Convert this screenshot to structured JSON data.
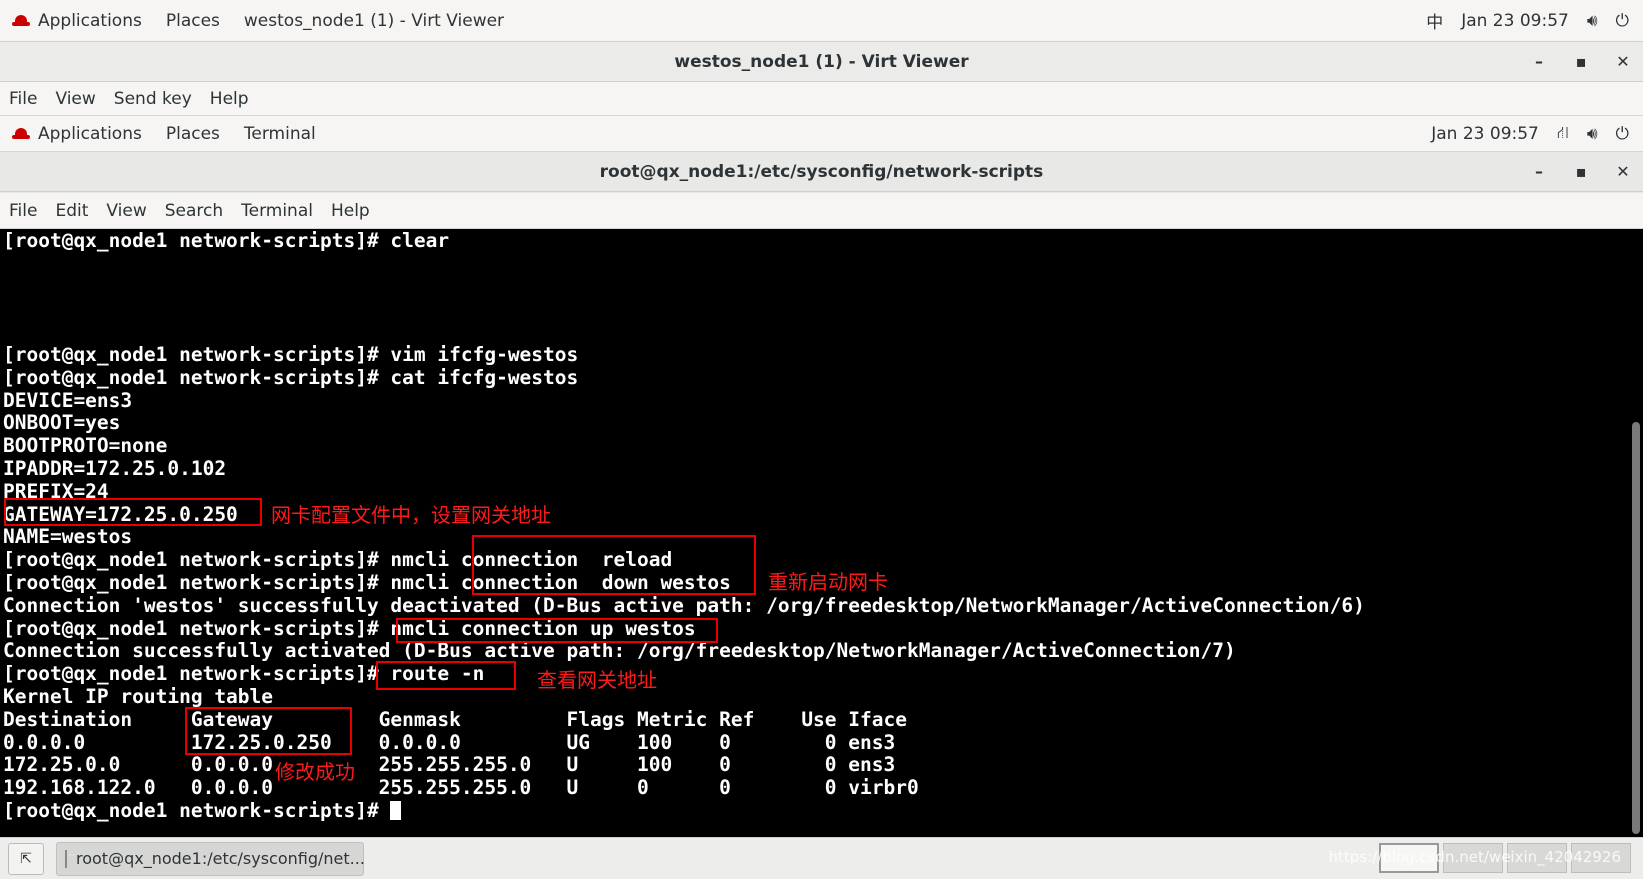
{
  "host_top_bar": {
    "applications": "Applications",
    "places": "Places",
    "window_title": "westos_node1 (1) - Virt Viewer",
    "input_method": "中",
    "datetime": "Jan 23  09:57"
  },
  "viewer_window": {
    "title": "westos_node1 (1) - Virt Viewer",
    "menu": [
      "File",
      "View",
      "Send key",
      "Help"
    ]
  },
  "guest_top_bar": {
    "applications": "Applications",
    "places": "Places",
    "app": "Terminal",
    "datetime": "Jan 23  09:57"
  },
  "terminal_window": {
    "title": "root@qx_node1:/etc/sysconfig/network-scripts",
    "menu": [
      "File",
      "Edit",
      "View",
      "Search",
      "Terminal",
      "Help"
    ]
  },
  "terminal": {
    "lines": [
      "[root@qx_node1 network-scripts]# clear",
      "",
      "",
      "",
      "",
      "[root@qx_node1 network-scripts]# vim ifcfg-westos",
      "[root@qx_node1 network-scripts]# cat ifcfg-westos",
      "DEVICE=ens3",
      "ONBOOT=yes",
      "BOOTPROTO=none",
      "IPADDR=172.25.0.102",
      "PREFIX=24",
      "GATEWAY=172.25.0.250",
      "NAME=westos",
      "[root@qx_node1 network-scripts]# nmcli connection  reload",
      "[root@qx_node1 network-scripts]# nmcli connection  down westos",
      "Connection 'westos' successfully deactivated (D-Bus active path: /org/freedesktop/NetworkManager/ActiveConnection/6)",
      "[root@qx_node1 network-scripts]# nmcli connection up westos",
      "Connection successfully activated (D-Bus active path: /org/freedesktop/NetworkManager/ActiveConnection/7)",
      "[root@qx_node1 network-scripts]# route -n",
      "Kernel IP routing table",
      "Destination     Gateway         Genmask         Flags Metric Ref    Use Iface",
      "0.0.0.0         172.25.0.250    0.0.0.0         UG    100    0        0 ens3",
      "172.25.0.0      0.0.0.0         255.255.255.0   U     100    0        0 ens3",
      "192.168.122.0   0.0.0.0         255.255.255.0   U     0      0        0 virbr0"
    ],
    "prompt": "[root@qx_node1 network-scripts]# "
  },
  "annotations": {
    "gateway_config": "网卡配置文件中，设置网关地址",
    "restart_nic": "重新启动网卡",
    "view_gateway": "查看网关地址",
    "modified_ok": "修改成功"
  },
  "taskbar": {
    "task_label": "root@qx_node1:/etc/sysconfig/net...",
    "watermark": "https://blog.csdn.net/weixin_42042926"
  },
  "colors": {
    "annotation": "#e60000",
    "terminal_bg": "#000000",
    "terminal_fg": "#ffffff"
  }
}
